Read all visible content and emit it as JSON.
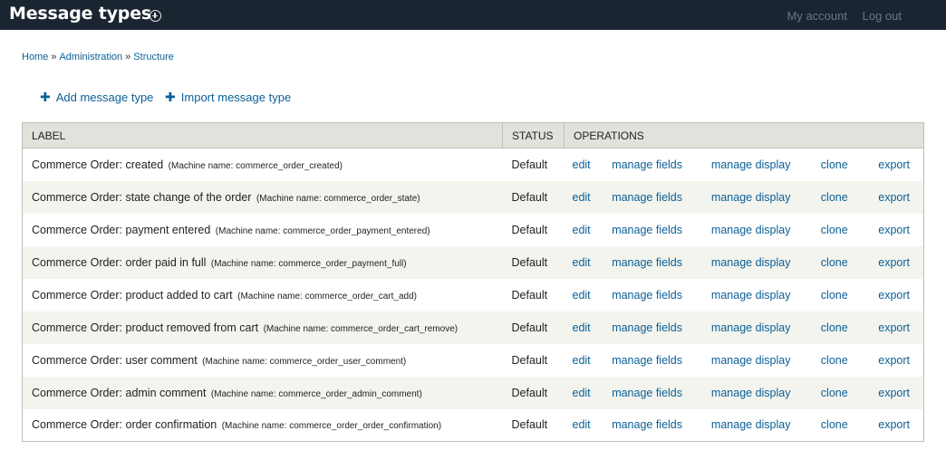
{
  "header": {
    "title": "Message types",
    "my_account": "My account",
    "logout": "Log out"
  },
  "breadcrumb": [
    "Home",
    "Administration",
    "Structure"
  ],
  "breadcrumb_separator": "»",
  "actions": {
    "add": "Add message type",
    "import": "Import message type"
  },
  "table": {
    "headers": {
      "label": "LABEL",
      "status": "STATUS",
      "operations": "OPERATIONS"
    },
    "operations": [
      "edit",
      "manage fields",
      "manage display",
      "clone",
      "export"
    ],
    "rows": [
      {
        "label": "Commerce Order: created",
        "machine": "(Machine name: commerce_order_created)",
        "status": "Default"
      },
      {
        "label": "Commerce Order: state change of the order",
        "machine": "(Machine name: commerce_order_state)",
        "status": "Default"
      },
      {
        "label": "Commerce Order: payment entered",
        "machine": "(Machine name: commerce_order_payment_entered)",
        "status": "Default"
      },
      {
        "label": "Commerce Order: order paid in full",
        "machine": "(Machine name: commerce_order_payment_full)",
        "status": "Default"
      },
      {
        "label": "Commerce Order: product added to cart",
        "machine": "(Machine name: commerce_order_cart_add)",
        "status": "Default"
      },
      {
        "label": "Commerce Order: product removed from cart",
        "machine": "(Machine name: commerce_order_cart_remove)",
        "status": "Default"
      },
      {
        "label": "Commerce Order: user comment",
        "machine": "(Machine name: commerce_order_user_comment)",
        "status": "Default"
      },
      {
        "label": "Commerce Order: admin comment",
        "machine": "(Machine name: commerce_order_admin_comment)",
        "status": "Default"
      },
      {
        "label": "Commerce Order: order confirmation",
        "machine": "(Machine name: commerce_order_order_confirmation)",
        "status": "Default"
      }
    ]
  },
  "colors": {
    "header_bg": "#1b2532",
    "link": "#0b5f96",
    "row_alt": "#f3f4ee",
    "table_head": "#e1e2dc"
  },
  "icons": {
    "shortcut": "add-shortcut-icon",
    "action": "plus-icon"
  }
}
